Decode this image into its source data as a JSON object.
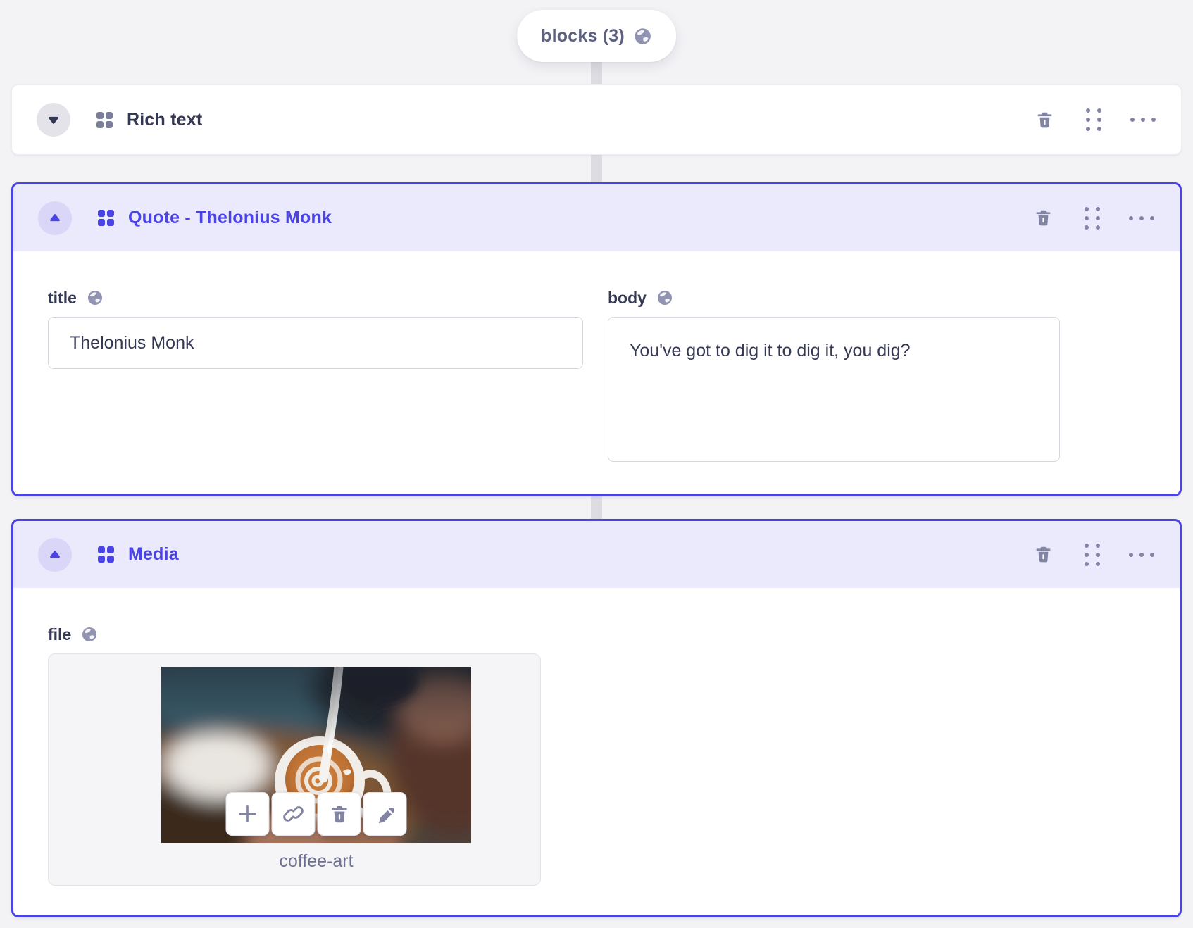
{
  "colors": {
    "accent": "#4a43e6",
    "active_header_bg": "#ebe9fc",
    "page_bg": "#f3f3f6",
    "icon_slate": "#8184a2",
    "text_dark": "#343853",
    "caption_slate": "#6d7090"
  },
  "pill": {
    "label": "blocks (3)",
    "icon": "globe-icon"
  },
  "blocks": {
    "rich_text": {
      "title": "Rich text",
      "state": "collapsed"
    },
    "quote": {
      "title": "Quote - Thelonius Monk",
      "state": "expanded",
      "fields": {
        "title": {
          "label": "title",
          "value": "Thelonius Monk"
        },
        "body": {
          "label": "body",
          "value": "You've got to dig it to dig it, you dig?"
        }
      }
    },
    "media": {
      "title": "Media",
      "state": "expanded",
      "fields": {
        "file": {
          "label": "file",
          "filename": "coffee-art",
          "preview": "latte-art-photo"
        }
      }
    }
  },
  "icons": {
    "pill": "globe-icon",
    "field_badge": "globe-icon",
    "collapse_open": "caret-up-icon",
    "collapse_closed": "caret-down-icon",
    "block_type": "blocks-grid-icon",
    "header_actions": [
      "trash-icon",
      "drag-handle-icon",
      "ellipsis-icon"
    ],
    "media_actions": [
      "plus-icon",
      "link-icon",
      "trash-icon",
      "pencil-icon"
    ]
  }
}
